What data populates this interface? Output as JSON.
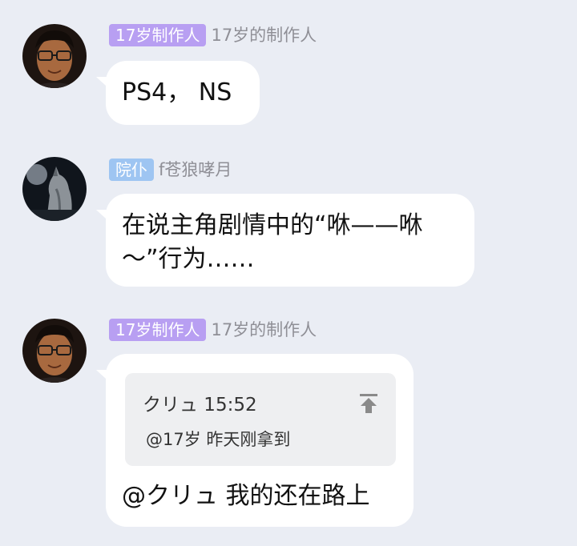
{
  "messages": [
    {
      "tag": "17岁制作人",
      "tag_color": "#b89ff2",
      "nickname": "17岁的制作人",
      "text": "PS4， NS"
    },
    {
      "tag": "院仆",
      "tag_color": "#9ec5f2",
      "nickname": "f苍狼哮月",
      "text_line1": "在说主角剧情中的“咻——咻",
      "text_line2": "～”行为……"
    },
    {
      "tag": "17岁制作人",
      "tag_color": "#b89ff2",
      "nickname": "17岁的制作人",
      "quote": {
        "author_time": "クリュ 15:52",
        "body": "@17岁 昨天刚拿到",
        "jump_icon": "jump-to-original-icon"
      },
      "text": "@クリュ 我的还在路上"
    }
  ],
  "colors": {
    "background": "#eaedf4",
    "bubble": "#ffffff",
    "nickname": "#8f8f96",
    "quote_bg": "#eeeff1"
  }
}
